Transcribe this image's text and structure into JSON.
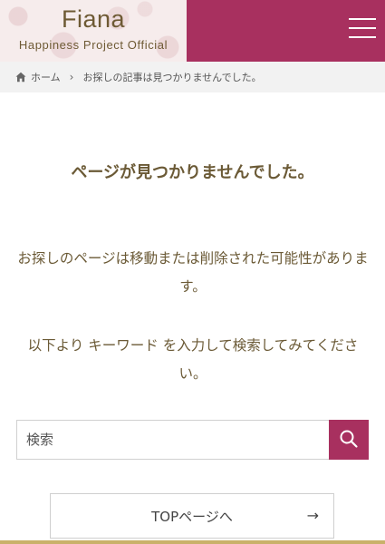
{
  "header": {
    "logo_title": "Fiana",
    "logo_subtitle": "Happiness Project Official",
    "menu_icon": "hamburger-icon",
    "menu_color": "#a8305f"
  },
  "breadcrumb": {
    "home_icon": "home-icon",
    "home_label": "ホーム",
    "separator": "›",
    "current": "お探しの記事は見つかりませんでした。"
  },
  "main": {
    "title": "ページが見つかりませんでした。",
    "paragraph1": "お探しのページは移動または削除された可能性があります。",
    "paragraph2": "以下より キーワード を入力して検索してみてください。"
  },
  "search": {
    "placeholder": "検索",
    "button_icon": "search-icon"
  },
  "top_button": {
    "label": "TOPページへ",
    "arrow": "→"
  },
  "colors": {
    "accent": "#a8305f",
    "text": "#6b5a36",
    "footer_bar": "#c9b16a"
  }
}
